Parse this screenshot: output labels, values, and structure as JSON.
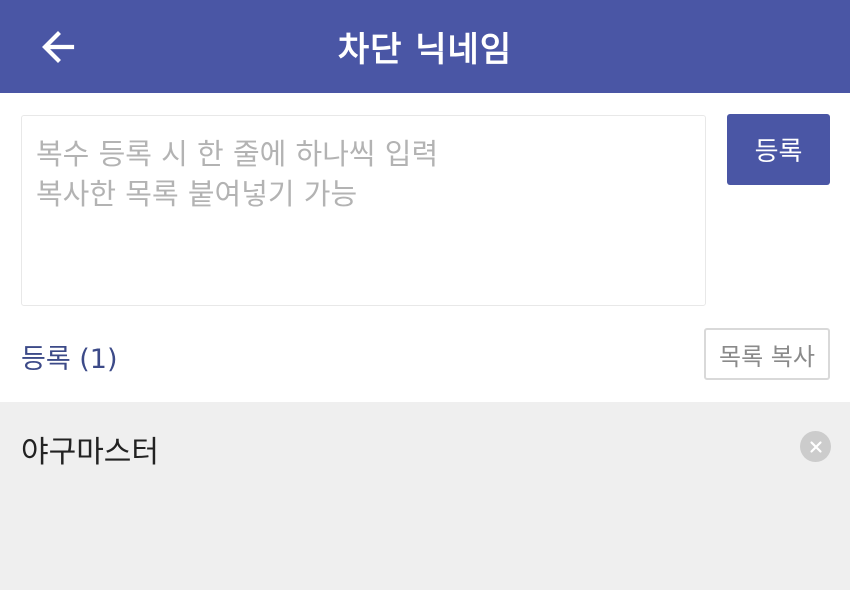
{
  "header": {
    "title": "차단 닉네임",
    "back_icon": "arrow-left-icon",
    "background_color": "#4a56a5"
  },
  "input": {
    "value": "",
    "placeholder": "복수 등록 시 한 줄에 하나씩 입력\n복사한 목록 붙여넣기 가능"
  },
  "register_button": {
    "label": "등록",
    "color": "#4a56a5"
  },
  "list": {
    "label": "등록 (1)",
    "copy_button_label": "목록 복사",
    "items": [
      {
        "name": "야구마스터",
        "remove_icon": "close-circle-icon"
      }
    ]
  }
}
